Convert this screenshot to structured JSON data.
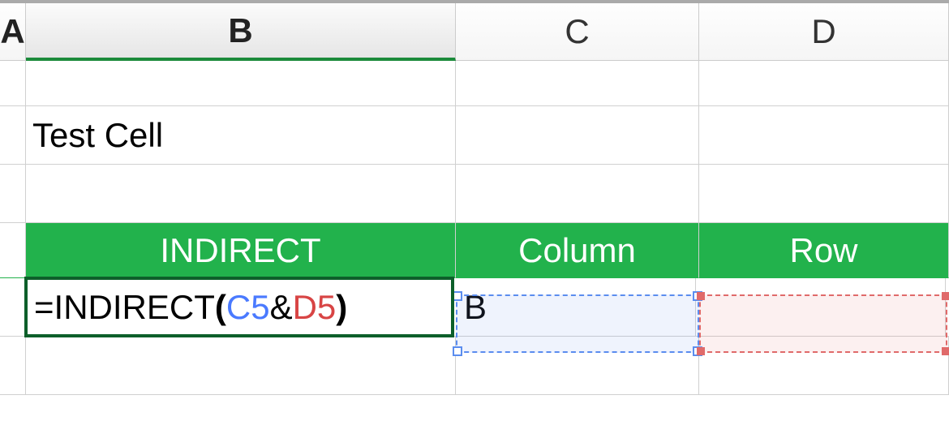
{
  "columns": {
    "a": "A",
    "b": "B",
    "c": "C",
    "d": "D"
  },
  "cells": {
    "b2": "Test Cell",
    "c5": "B"
  },
  "headers": {
    "b4": "INDIRECT",
    "c4": "Column",
    "d4": "Row"
  },
  "formula": {
    "prefix": "=",
    "func": "INDIRECT",
    "open": "(",
    "ref1": "C5",
    "amp": "&",
    "ref2": "D5",
    "close": ")"
  },
  "selection": {
    "active_column": "B",
    "editing_cell": "B5",
    "ref_cells": [
      "C5",
      "D5"
    ]
  }
}
